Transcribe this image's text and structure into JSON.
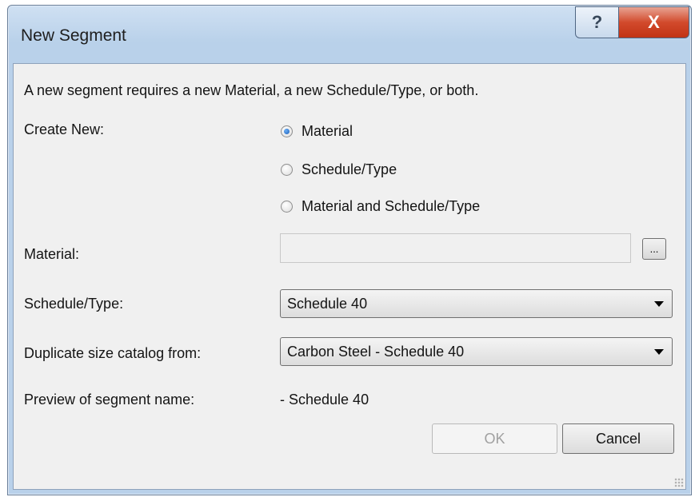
{
  "window": {
    "title": "New Segment"
  },
  "caption": {
    "help": "?",
    "close": "X"
  },
  "intro_text": "A new segment requires a new Material, a new Schedule/Type, or both.",
  "create_new": {
    "label": "Create New:",
    "options": [
      {
        "label": "Material",
        "selected": true
      },
      {
        "label": "Schedule/Type",
        "selected": false
      },
      {
        "label": "Material and Schedule/Type",
        "selected": false
      }
    ]
  },
  "material": {
    "label": "Material:",
    "value": "",
    "browse_label": "..."
  },
  "schedule_type": {
    "label": "Schedule/Type:",
    "value": "Schedule 40"
  },
  "duplicate_catalog": {
    "label": "Duplicate size catalog from:",
    "value": "Carbon Steel - Schedule 40"
  },
  "preview": {
    "label": "Preview of segment name:",
    "value": "- Schedule 40"
  },
  "buttons": {
    "ok": "OK",
    "cancel": "Cancel"
  },
  "colors": {
    "title_bar": "#b9d1ea",
    "close_button": "#c13315",
    "dialog_background": "#f0f0f0",
    "radio_selected": "#1d5fb8"
  }
}
